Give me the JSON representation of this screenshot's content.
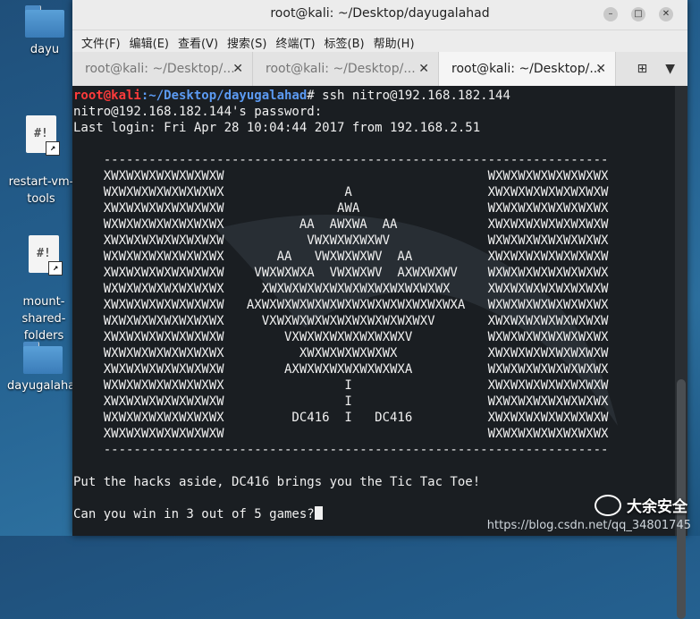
{
  "desktop": {
    "icons": [
      {
        "label": "dayu"
      },
      {
        "label": "restart-vm-\ntools"
      },
      {
        "label": "mount-\nshared-\nfolders"
      },
      {
        "label": "dayugalahad"
      }
    ]
  },
  "window": {
    "title": "root@kali: ~/Desktop/dayugalahad",
    "menu": [
      "文件(F)",
      "编辑(E)",
      "查看(V)",
      "搜索(S)",
      "终端(T)",
      "标签(B)",
      "帮助(H)"
    ],
    "tabs": [
      {
        "label": "root@kali: ~/Desktop/..."
      },
      {
        "label": "root@kali: ~/Desktop/..."
      },
      {
        "label": "root@kali: ~/Desktop/..."
      }
    ]
  },
  "terminal": {
    "prompt_user": "root@kali",
    "prompt_path": ":~/Desktop/dayugalahad",
    "prompt_cmd": "# ssh nitro@192.168.182.144",
    "body": "nitro@192.168.182.144's password:\nLast login: Fri Apr 28 10:04:44 2017 from 192.168.2.51\n\n    -------------------------------------------------------------------\n    XWXWXWXWXWXWXWXW                                   WXWXWXWXWXWXWXWX\n    WXWXWXWXWXWXWXWX                A                  XWXWXWXWXWXWXWXW\n    XWXWXWXWXWXWXWXW               AWA                 WXWXWXWXWXWXWXWX\n    WXWXWXWXWXWXWXWX          AA  AWXWA  AA            XWXWXWXWXWXWXWXW\n    XWXWXWXWXWXWXWXW           VWXWXWXWXWV             WXWXWXWXWXWXWXWX\n    WXWXWXWXWXWXWXWX       AA   VWXWXWXWV  AA          XWXWXWXWXWXWXWXW\n    XWXWXWXWXWXWXWXW    VWXWXWXA  VWXWXWV  AXWXWXWV    WXWXWXWXWXWXWXWX\n    WXWXWXWXWXWXWXWX     XWXWXWXWXWXWXWXWXWXWXWXWX     XWXWXWXWXWXWXWXW\n    XWXWXWXWXWXWXWXW   AXWXWXWXWXWXWXWXWXWXWXWXWXWXA   WXWXWXWXWXWXWXWX\n    WXWXWXWXWXWXWXWX     VXWXWXWXWXWXWXWXWXWXWXV       XWXWXWXWXWXWXWXW\n    XWXWXWXWXWXWXWXW        VXWXWXWXWXWXWXWXV          WXWXWXWXWXWXWXWX\n    WXWXWXWXWXWXWXWX          XWXWXWXWXWXWX            XWXWXWXWXWXWXWXW\n    XWXWXWXWXWXWXWXW        AXWXWXWXWXWXWXWXA          WXWXWXWXWXWXWXWX\n    WXWXWXWXWXWXWXWX                I                  XWXWXWXWXWXWXWXW\n    XWXWXWXWXWXWXWXW                I                  WXWXWXWXWXWXWXWX\n    WXWXWXWXWXWXWXWX         DC416  I   DC416          XWXWXWXWXWXWXWXW\n    XWXWXWXWXWXWXWXW                                   WXWXWXWXWXWXWXWX\n    -------------------------------------------------------------------\n\nPut the hacks aside, DC416 brings you the Tic Tac Toe!\n\nCan you win in 3 out of 5 games?"
  },
  "watermark": {
    "brand": "大余安全",
    "url": "https://blog.csdn.net/qq_34801745"
  }
}
